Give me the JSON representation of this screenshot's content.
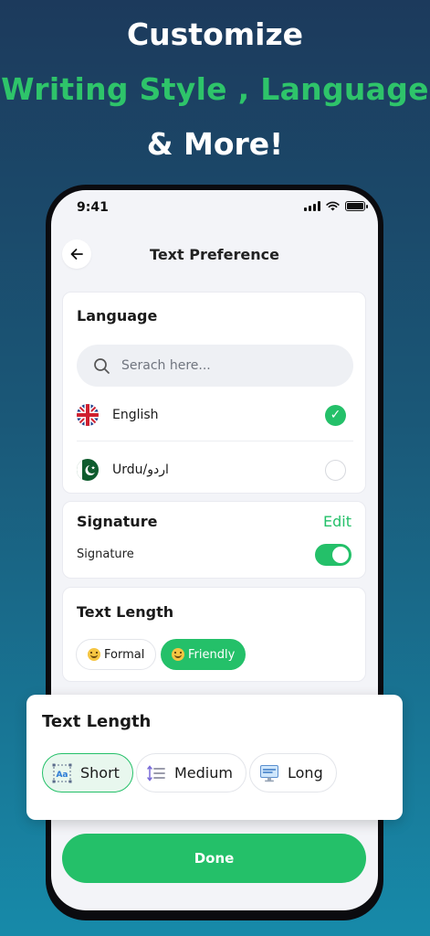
{
  "promo": {
    "line1": "Customize",
    "line2": "Writing Style , Language",
    "line3": "& More!"
  },
  "status_bar": {
    "time": "9:41"
  },
  "header": {
    "title": "Text Preference",
    "back_icon": "arrow-left-icon"
  },
  "language_card": {
    "title": "Language",
    "search_placeholder": "Serach here...",
    "items": [
      {
        "label": "English",
        "flag": "uk-flag-icon",
        "selected": true
      },
      {
        "label": "Urdu/اردو",
        "flag": "pakistan-flag-icon",
        "selected": false
      }
    ]
  },
  "signature_card": {
    "title": "Signature",
    "edit_label": "Edit",
    "toggle_label": "Signature",
    "toggle_on": true
  },
  "text_length_card": {
    "title": "Text Length",
    "options": [
      {
        "label": "Formal",
        "selected": false
      },
      {
        "label": "Friendly",
        "selected": true
      }
    ]
  },
  "text_length_popup": {
    "title": "Text Length",
    "options": [
      {
        "label": "Short",
        "icon": "text-aa-icon",
        "selected": true
      },
      {
        "label": "Medium",
        "icon": "line-spacing-icon",
        "selected": false
      },
      {
        "label": "Long",
        "icon": "monitor-text-icon",
        "selected": false
      }
    ]
  },
  "done_button": {
    "label": "Done"
  },
  "colors": {
    "accent": "#24c069",
    "headline_green": "#2ec46a",
    "bg_top": "#1c3a5c",
    "bg_bottom": "#178aa9"
  }
}
